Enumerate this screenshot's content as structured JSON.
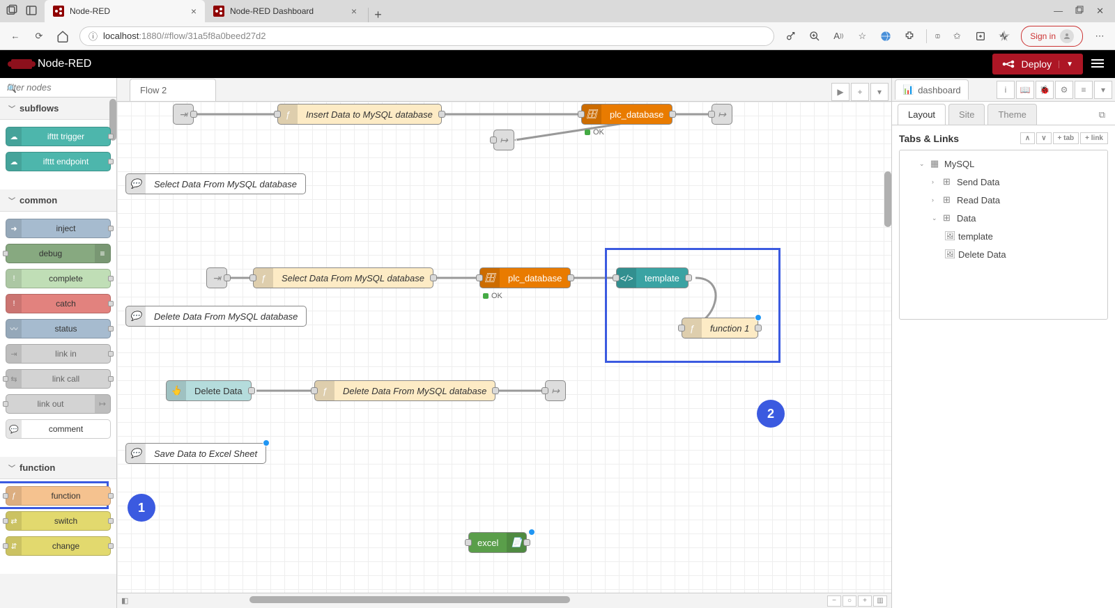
{
  "browser": {
    "tabs": [
      {
        "title": "Node-RED",
        "active": true
      },
      {
        "title": "Node-RED Dashboard",
        "active": false
      }
    ],
    "url_host": "localhost",
    "url_port": ":1880",
    "url_path": "/#flow/31a5f8a0beed27d2",
    "signin": "Sign in"
  },
  "header": {
    "app": "Node-RED",
    "deploy": "Deploy"
  },
  "palette": {
    "filter_placeholder": "filter nodes",
    "cat_subflows": "subflows",
    "cat_common": "common",
    "cat_function": "function",
    "nodes": {
      "ifttt_trigger": "ifttt trigger",
      "ifttt_endpoint": "ifttt endpoint",
      "inject": "inject",
      "debug": "debug",
      "complete": "complete",
      "catch": "catch",
      "status": "status",
      "link_in": "link in",
      "link_call": "link call",
      "link_out": "link out",
      "comment": "comment",
      "function": "function",
      "switch": "switch",
      "change": "change"
    }
  },
  "workspace": {
    "tab": "Flow 2",
    "nodes": {
      "insert_data": "Insert Data to MySQL database",
      "plc_db1": "plc_database",
      "ok1": "OK",
      "sel_comment": "Select Data From MySQL database",
      "sel_func": "Select Data From MySQL database",
      "plc_db2": "plc_database",
      "ok2": "OK",
      "template": "template",
      "function1": "function 1",
      "del_comment": "Delete Data From MySQL database",
      "delete_data_btn": "Delete Data",
      "del_func": "Delete Data From MySQL database",
      "save_excel": "Save Data to Excel Sheet",
      "excel": "excel"
    },
    "badges": {
      "one": "1",
      "two": "2"
    }
  },
  "sidebar": {
    "tab": "dashboard",
    "subtabs": {
      "layout": "Layout",
      "site": "Site",
      "theme": "Theme"
    },
    "section": "Tabs & Links",
    "btns": {
      "tab": "+ tab",
      "link": "+ link"
    },
    "tree": {
      "mysql": "MySQL",
      "send": "Send Data",
      "read": "Read Data",
      "data": "Data",
      "template": "template",
      "delete": "Delete Data"
    }
  }
}
